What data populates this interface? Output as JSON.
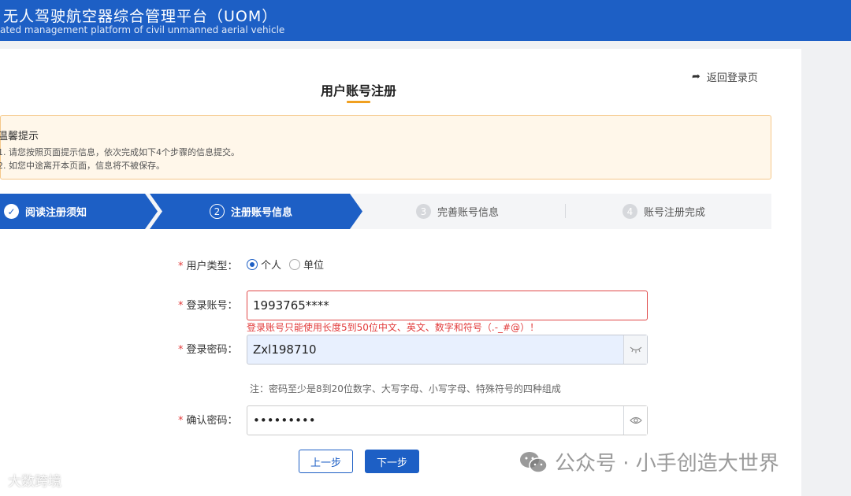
{
  "header": {
    "title": "无人驾驶航空器综合管理平台（UOM）",
    "subtitle": "ated management platform of civil unmanned aerial vehicle"
  },
  "page": {
    "title": "用户账号注册",
    "back_label": "返回登录页"
  },
  "notice": {
    "title": "温馨提示",
    "lines": [
      "1. 请您按照页面提示信息，依次完成如下4个步骤的信息提交。",
      "2. 如您中途离开本页面，信息将不被保存。"
    ]
  },
  "steps": [
    {
      "num": "✓",
      "label": "阅读注册须知",
      "state": "done"
    },
    {
      "num": "2",
      "label": "注册账号信息",
      "state": "active"
    },
    {
      "num": "3",
      "label": "完善账号信息",
      "state": "todo"
    },
    {
      "num": "4",
      "label": "账号注册完成",
      "state": "todo"
    }
  ],
  "form": {
    "user_type": {
      "label": "用户类型：",
      "options": [
        "个人",
        "单位"
      ],
      "selected": "个人"
    },
    "account": {
      "label": "登录账号：",
      "value": "1993765****",
      "error": "登录账号只能使用长度5到50位中文、英文、数字和符号（.-_#@）！"
    },
    "password": {
      "label": "登录密码：",
      "value": "Zxl198710",
      "note": "注：密码至少是8到20位数字、大写字母、小写字母、特殊符号的四种组成"
    },
    "confirm": {
      "label": "确认密码：",
      "value": "•••••••••"
    },
    "required_mark": "*"
  },
  "buttons": {
    "prev": "上一步",
    "next": "下一步"
  },
  "watermarks": {
    "left": "大数跨境",
    "right": "公众号 · 小手创造大世界"
  },
  "colors": {
    "primary": "#1d5fc5",
    "error": "#e23c3c",
    "notice_bg": "#fff7ea",
    "accent": "#f0a020"
  }
}
